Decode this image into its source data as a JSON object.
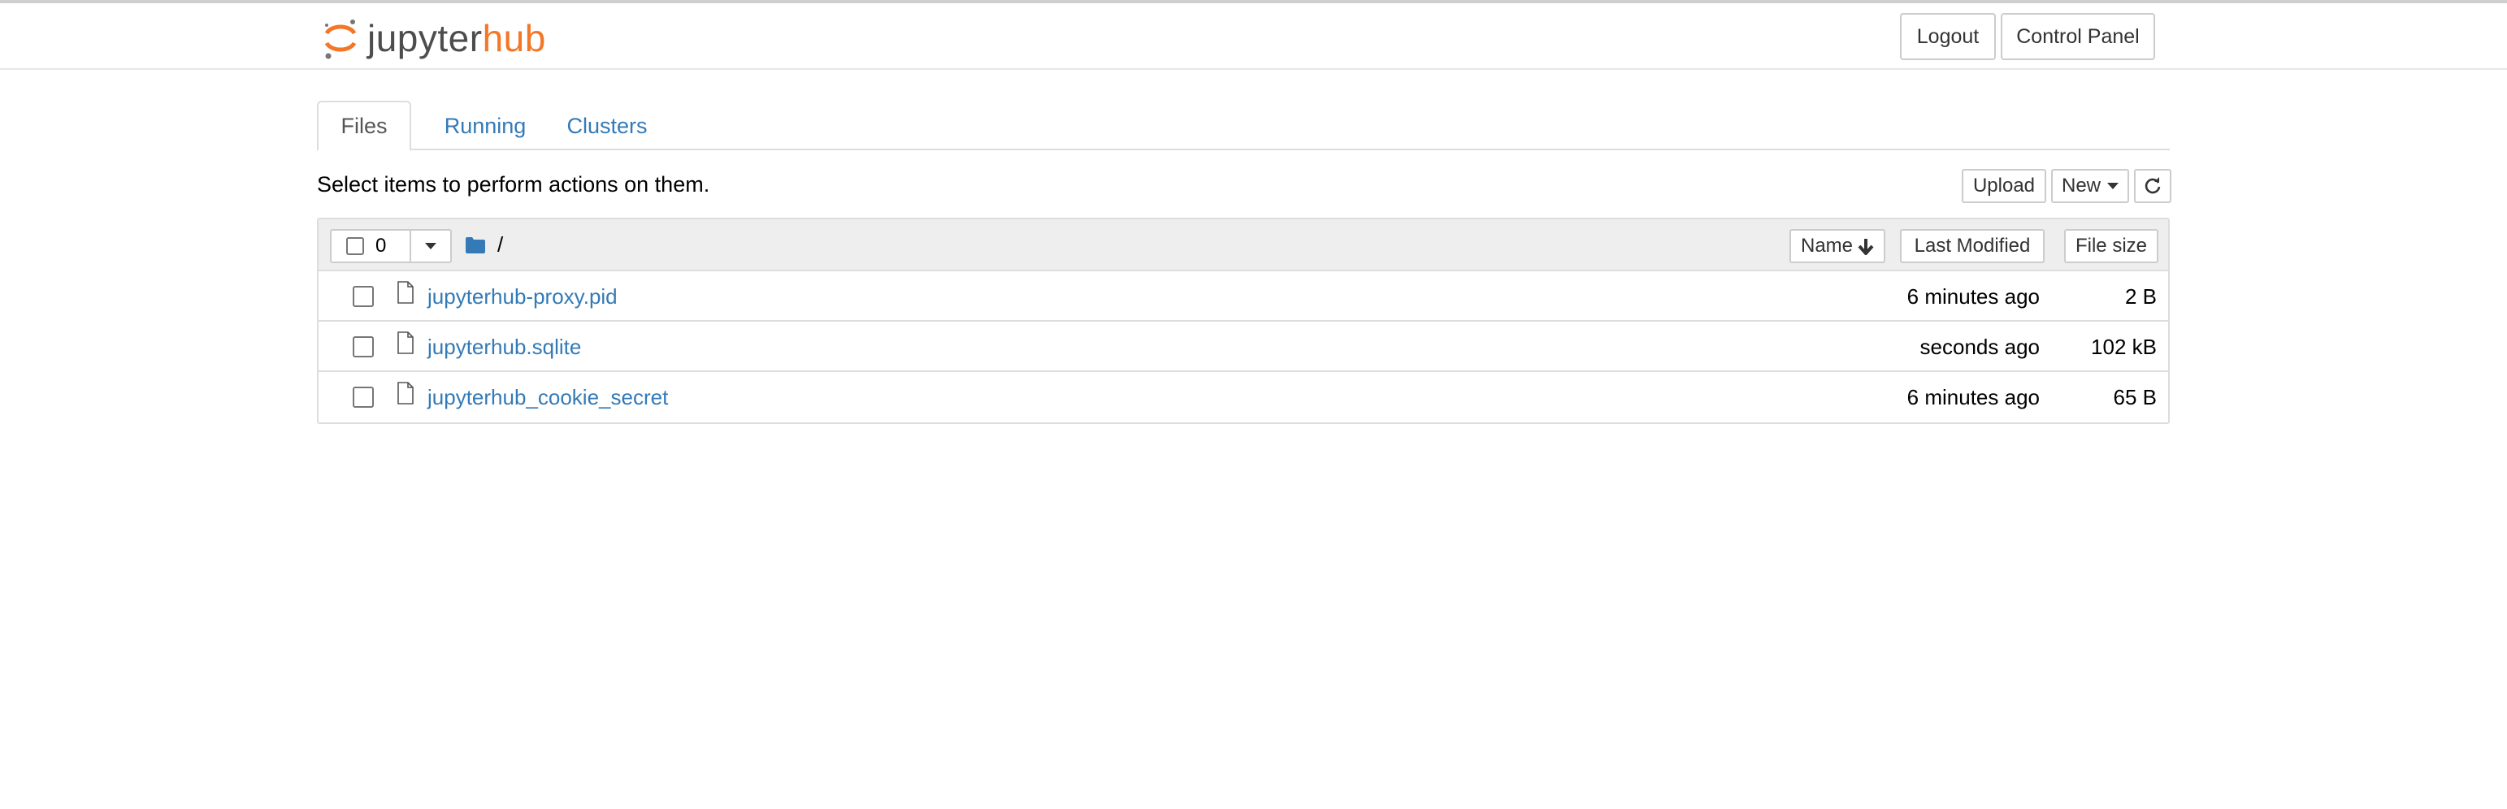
{
  "header": {
    "logo_prefix": "jupyter",
    "logo_suffix": "hub",
    "logout_label": "Logout",
    "control_panel_label": "Control Panel"
  },
  "tabs": [
    {
      "label": "Files",
      "active": true
    },
    {
      "label": "Running",
      "active": false
    },
    {
      "label": "Clusters",
      "active": false
    }
  ],
  "toolbar": {
    "select_message": "Select items to perform actions on them.",
    "upload_label": "Upload",
    "new_label": "New"
  },
  "list_header": {
    "selected_count": "0",
    "path": "/",
    "sort_name_label": "Name",
    "sort_modified_label": "Last Modified",
    "sort_size_label": "File size"
  },
  "files": [
    {
      "name": "jupyterhub-proxy.pid",
      "modified": "6 minutes ago",
      "size": "2 B"
    },
    {
      "name": "jupyterhub.sqlite",
      "modified": "seconds ago",
      "size": "102 kB"
    },
    {
      "name": "jupyterhub_cookie_secret",
      "modified": "6 minutes ago",
      "size": "65 B"
    }
  ],
  "colors": {
    "link": "#337ab7",
    "brand_orange": "#f37726",
    "header_gray": "#eeeeee"
  },
  "icons": {
    "logo": "jupyter-logo-icon",
    "caret": "caret-down-icon",
    "refresh": "refresh-icon",
    "folder": "folder-icon",
    "file": "file-icon",
    "sort": "arrow-down-icon"
  }
}
